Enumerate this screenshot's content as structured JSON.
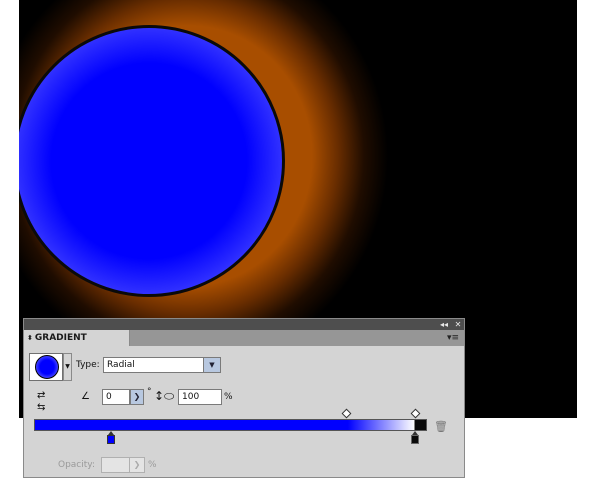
{
  "panel": {
    "title": "GRADIENT",
    "collapse_glyph": "◂◂",
    "close_glyph": "✕",
    "menu_glyph": "▾≡"
  },
  "gradient": {
    "type_label": "Type:",
    "type_value": "Radial",
    "angle_value": "0",
    "degree_symbol": "°",
    "aspect_value": "100",
    "aspect_unit": "%",
    "opacity_label": "Opacity:",
    "opacity_value": "",
    "opacity_unit": "%"
  },
  "ramp": {
    "stops": [
      {
        "position": 0.2,
        "color": "#0000ff"
      },
      {
        "position": 0.975,
        "color": "#0a0a0a"
      }
    ],
    "midpoints": [
      0.8,
      0.975
    ]
  },
  "colors": {
    "canvas": "#000000",
    "glow": "#a84e00",
    "circle_center": "#0000ff",
    "circle_edge": "#ffffff",
    "panel_bg": "#d4d4d4"
  },
  "icons": {
    "preview_dropdown": "chevron-down-icon",
    "reverse": "reverse-gradient-icon",
    "angle": "angle-icon",
    "aspect": "aspect-ratio-icon",
    "delete": "trash-icon"
  }
}
